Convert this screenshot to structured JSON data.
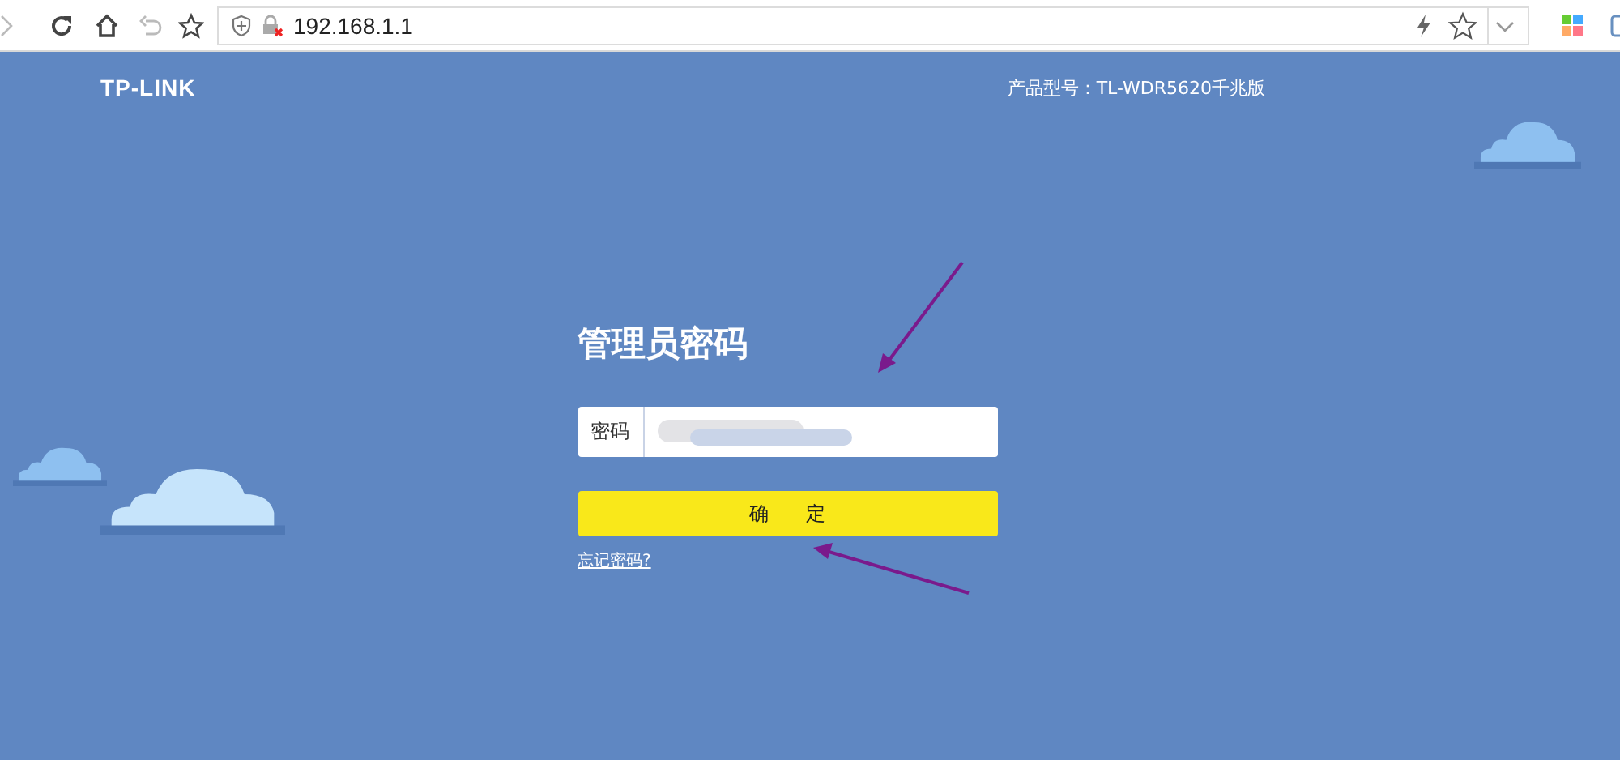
{
  "browser": {
    "address": "192.168.1.1"
  },
  "header": {
    "logo": "TP-LINK",
    "model": "产品型号：TL-WDR5620千兆版"
  },
  "login": {
    "title": "管理员密码",
    "field_label": "密码",
    "submit": "确 定",
    "forgot_link": "忘记密码?"
  }
}
